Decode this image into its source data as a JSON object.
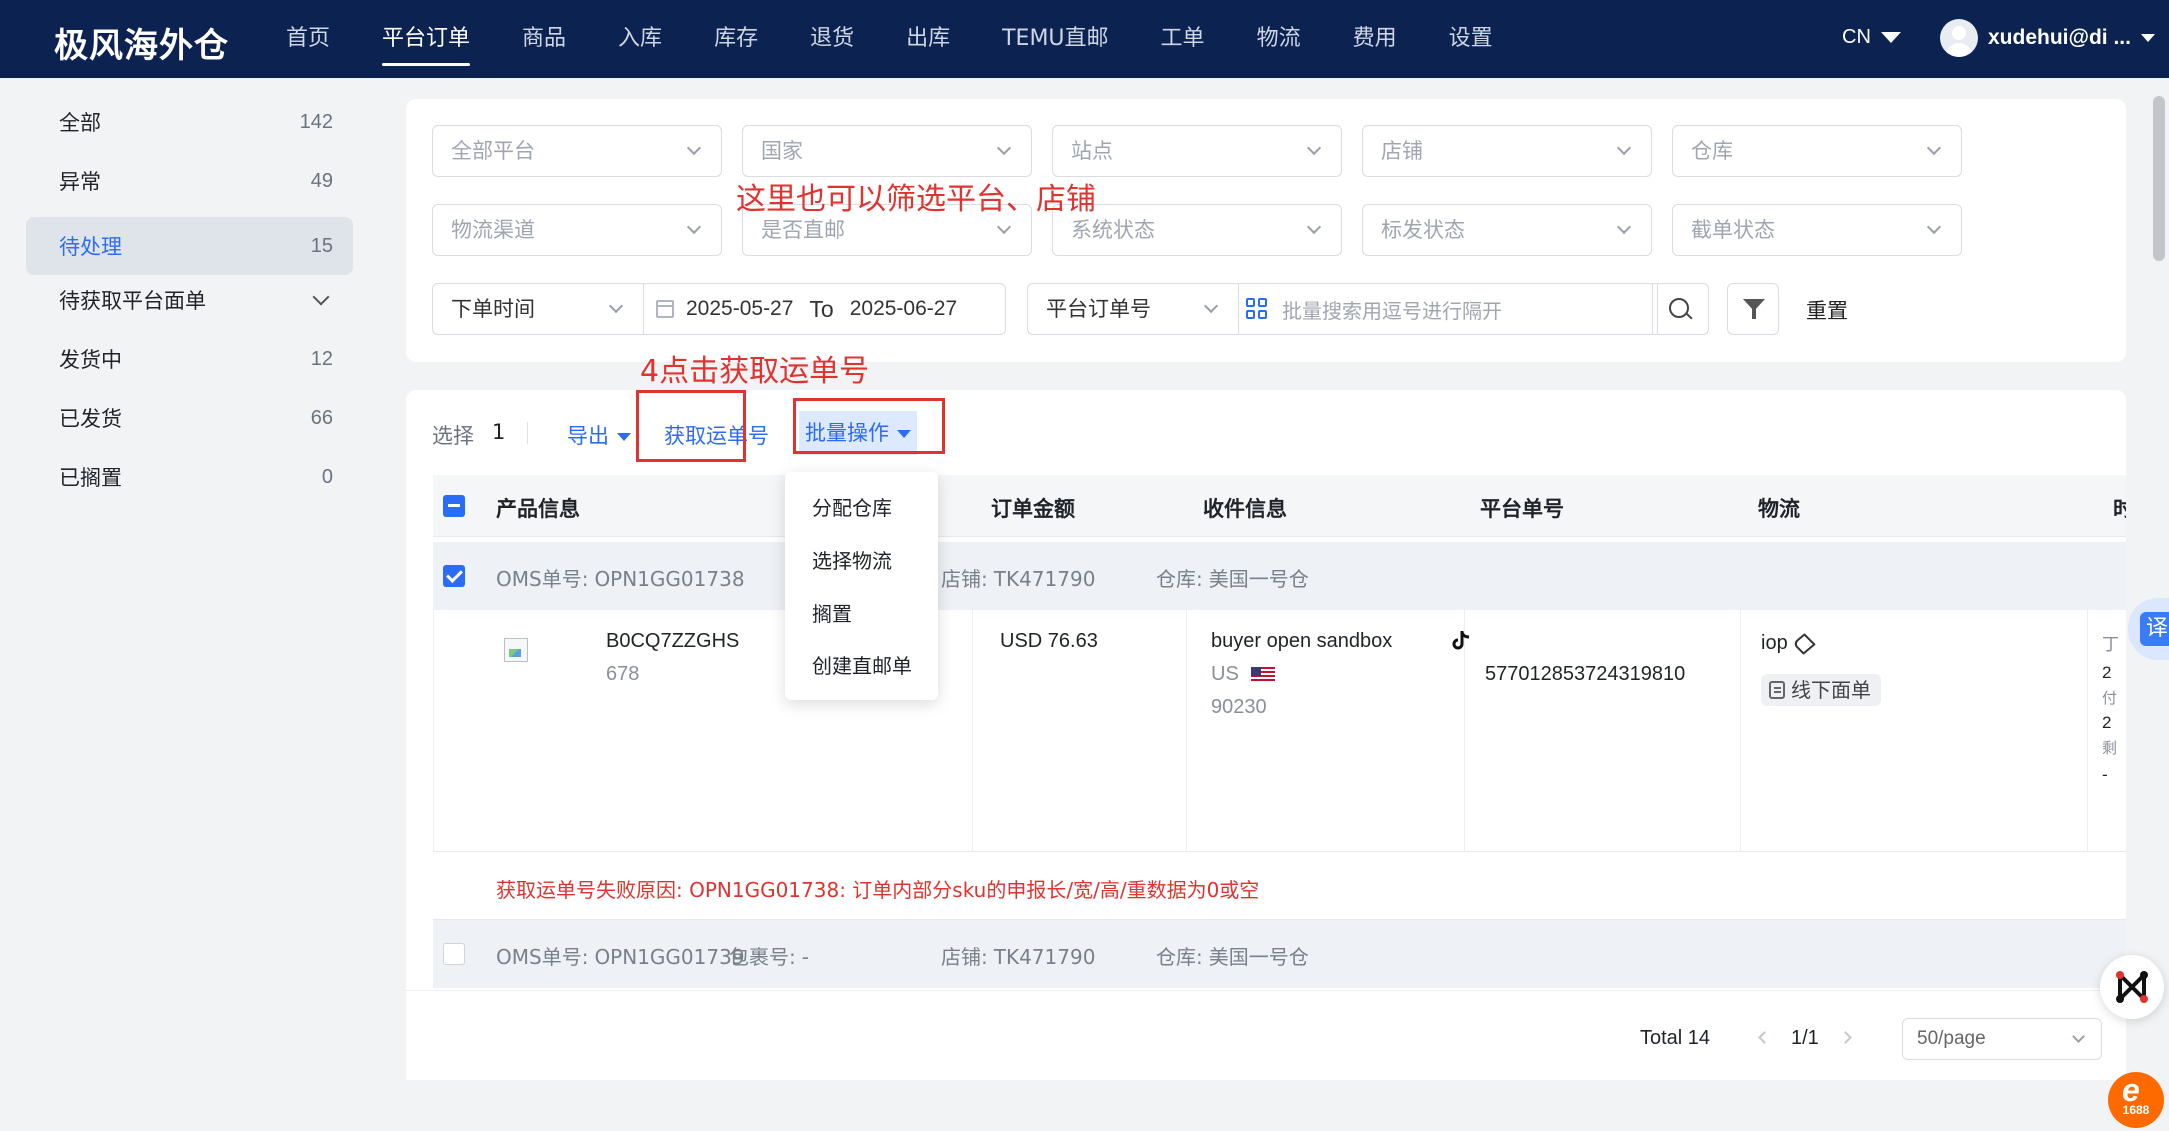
{
  "brand": "极风海外仓",
  "nav": [
    "首页",
    "平台订单",
    "商品",
    "入库",
    "库存",
    "退货",
    "出库",
    "TEMU直邮",
    "工单",
    "物流",
    "费用",
    "设置"
  ],
  "nav_active": "平台订单",
  "lang": "CN",
  "user": "xudehui@di ...",
  "sidebar": [
    {
      "label": "全部",
      "count": "142"
    },
    {
      "label": "异常",
      "count": "49"
    },
    {
      "label": "待处理",
      "count": "15"
    },
    {
      "label": "待获取平台面单",
      "count": ""
    },
    {
      "label": "发货中",
      "count": "12"
    },
    {
      "label": "已发货",
      "count": "66"
    },
    {
      "label": "已搁置",
      "count": "0"
    }
  ],
  "filters": {
    "row1": [
      "全部平台",
      "国家",
      "站点",
      "店铺",
      "仓库"
    ],
    "row2": [
      "物流渠道",
      "是否直邮",
      "系统状态",
      "标发状态",
      "截单状态"
    ],
    "time_type": "下单时间",
    "date_from": "2025-05-27",
    "date_to_label": "To",
    "date_to": "2025-06-27",
    "search_type": "平台订单号",
    "search_placeholder": "批量搜索用逗号进行隔开",
    "reset": "重置"
  },
  "annotations": {
    "filter_note": "这里也可以筛选平台、店铺",
    "step_note": "4点击获取运单号"
  },
  "toolbar": {
    "select_label": "选择",
    "select_count": "1",
    "export": "导出",
    "get_tracking": "获取运单号",
    "batch_ops": "批量操作"
  },
  "batch_menu": [
    "分配仓库",
    "选择物流",
    "搁置",
    "创建直邮单"
  ],
  "table": {
    "headers": [
      "产品信息",
      "订单金额",
      "收件信息",
      "平台单号",
      "物流",
      "时"
    ],
    "group1": {
      "oms_label": "OMS单号:",
      "oms": "OPN1GG01738",
      "shop_label": "店铺:",
      "shop": "TK471790",
      "wh_label": "仓库:",
      "wh": "美国一号仓"
    },
    "row": {
      "sku": "B0CQ7ZZGHS",
      "qty": "678",
      "amount": "USD 76.63",
      "buyer": "buyer open sandbox",
      "country": "US",
      "zip": "90230",
      "platform_no": "577012853724319810",
      "logistics": "iop",
      "label_type": "线下面单",
      "time_chars": [
        "丁",
        "2",
        "付",
        "2",
        "剩",
        "-"
      ]
    },
    "error": "获取运单号失败原因: OPN1GG01738: 订单内部分sku的申报长/宽/高/重数据为0或空",
    "group2": {
      "oms_label": "OMS单号:",
      "oms": "OPN1GG01739",
      "pkg_label": "包裹号:",
      "pkg": "-",
      "shop_label": "店铺:",
      "shop": "TK471790",
      "wh_label": "仓库:",
      "wh": "美国一号仓"
    }
  },
  "pager": {
    "total": "Total 14",
    "page": "1/1",
    "page_size": "50/page"
  },
  "float": {
    "translate": "译",
    "logo_1688": "1688"
  },
  "colors": {
    "nav_bg": "#0c2352",
    "accent": "#2b6cf6",
    "annotation": "#e0332f"
  }
}
